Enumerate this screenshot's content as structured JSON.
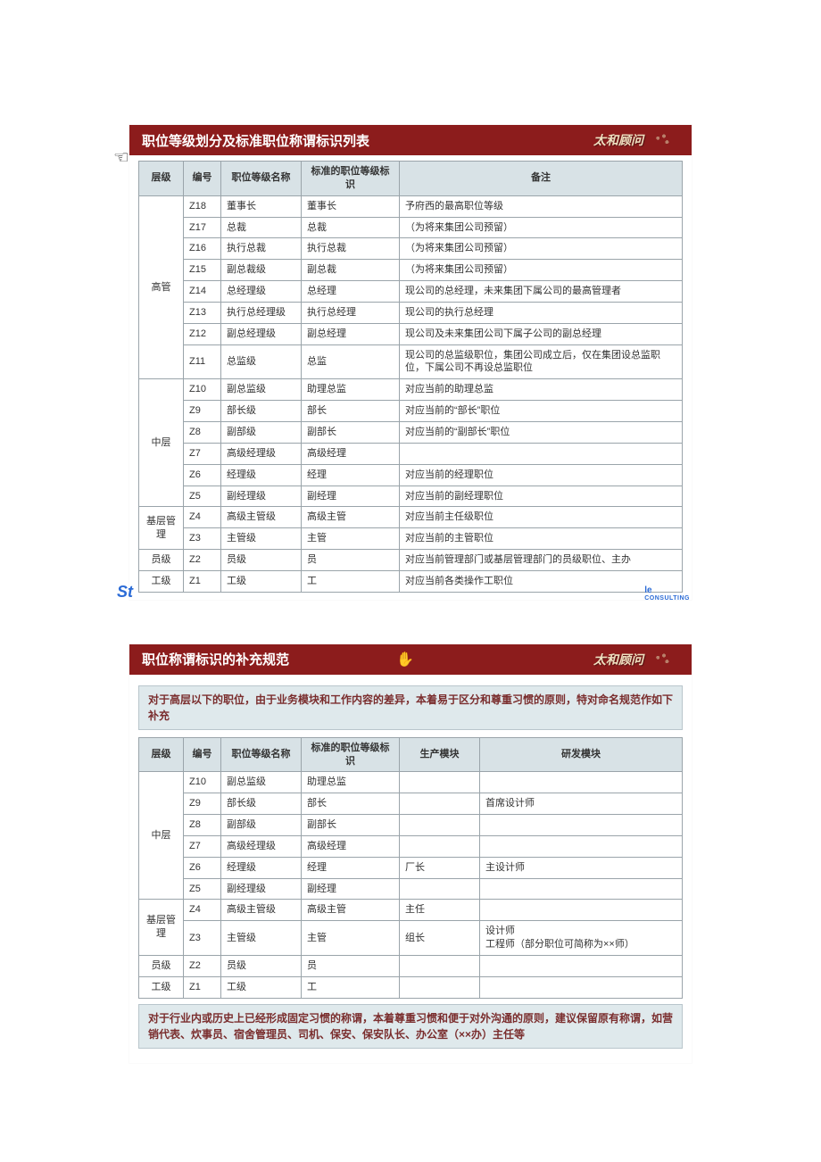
{
  "brand": "太和顾问",
  "footer_right": "le",
  "footer_right_sub": "CONSULTING",
  "footer_left": "St",
  "slide1": {
    "title": "职位等级划分及标准职位称谓标识列表",
    "headers": [
      "层级",
      "编号",
      "职位等级名称",
      "标准的职位等级标识",
      "备注"
    ],
    "groups": [
      {
        "level": "高管",
        "rows": [
          [
            "Z18",
            "董事长",
            "董事长",
            "予府西的最高职位等级"
          ],
          [
            "Z17",
            "总裁",
            "总裁",
            "（为将来集团公司预留）"
          ],
          [
            "Z16",
            "执行总裁",
            "执行总裁",
            "（为将来集团公司预留）"
          ],
          [
            "Z15",
            "副总裁级",
            "副总裁",
            "（为将来集团公司预留）"
          ],
          [
            "Z14",
            "总经理级",
            "总经理",
            "现公司的总经理，未来集团下属公司的最高管理者"
          ],
          [
            "Z13",
            "执行总经理级",
            "执行总经理",
            "现公司的执行总经理"
          ],
          [
            "Z12",
            "副总经理级",
            "副总经理",
            "现公司及未来集团公司下属子公司的副总经理"
          ],
          [
            "Z11",
            "总监级",
            "总监",
            "现公司的总监级职位，集团公司成立后，仅在集团设总监职位，下属公司不再设总监职位"
          ]
        ]
      },
      {
        "level": "中层",
        "rows": [
          [
            "Z10",
            "副总监级",
            "助理总监",
            "对应当前的助理总监"
          ],
          [
            "Z9",
            "部长级",
            "部长",
            "对应当前的“部长”职位"
          ],
          [
            "Z8",
            "副部级",
            "副部长",
            "对应当前的“副部长”职位"
          ],
          [
            "Z7",
            "高级经理级",
            "高级经理",
            ""
          ],
          [
            "Z6",
            "经理级",
            "经理",
            "对应当前的经理职位"
          ],
          [
            "Z5",
            "副经理级",
            "副经理",
            "对应当前的副经理职位"
          ]
        ]
      },
      {
        "level": "基层管理",
        "rows": [
          [
            "Z4",
            "高级主管级",
            "高级主管",
            "对应当前主任级职位"
          ],
          [
            "Z3",
            "主管级",
            "主管",
            "对应当前的主管职位"
          ]
        ]
      },
      {
        "level": "员级",
        "rows": [
          [
            "Z2",
            "员级",
            "员",
            "对应当前管理部门或基层管理部门的员级职位、主办"
          ]
        ]
      },
      {
        "level": "工级",
        "rows": [
          [
            "Z1",
            "工级",
            "工",
            "对应当前各类操作工职位"
          ]
        ]
      }
    ]
  },
  "slide2": {
    "title": "职位称谓标识的补充规范",
    "intro": "对于高层以下的职位，由于业务模块和工作内容的差异，本着易于区分和尊重习惯的原则，特对命名规范作如下补充",
    "headers": [
      "层级",
      "编号",
      "职位等级名称",
      "标准的职位等级标识",
      "生产模块",
      "研发模块"
    ],
    "groups": [
      {
        "level": "中层",
        "rows": [
          [
            "Z10",
            "副总监级",
            "助理总监",
            "",
            ""
          ],
          [
            "Z9",
            "部长级",
            "部长",
            "",
            "首席设计师"
          ],
          [
            "Z8",
            "副部级",
            "副部长",
            "",
            ""
          ],
          [
            "Z7",
            "高级经理级",
            "高级经理",
            "",
            ""
          ],
          [
            "Z6",
            "经理级",
            "经理",
            "厂长",
            "主设计师"
          ],
          [
            "Z5",
            "副经理级",
            "副经理",
            "",
            ""
          ]
        ]
      },
      {
        "level": "基层管理",
        "rows": [
          [
            "Z4",
            "高级主管级",
            "高级主管",
            "主任",
            ""
          ],
          [
            "Z3",
            "主管级",
            "主管",
            "组长",
            "设计师\n工程师（部分职位可简称为××师）"
          ]
        ]
      },
      {
        "level": "员级",
        "rows": [
          [
            "Z2",
            "员级",
            "员",
            "",
            ""
          ]
        ]
      },
      {
        "level": "工级",
        "rows": [
          [
            "Z1",
            "工级",
            "工",
            "",
            ""
          ]
        ]
      }
    ],
    "outro": "对于行业内或历史上已经形成固定习惯的称谓，本着尊重习惯和便于对外沟通的原则，建议保留原有称谓，如营销代表、炊事员、宿舍管理员、司机、保安、保安队长、办公室（××办）主任等"
  }
}
